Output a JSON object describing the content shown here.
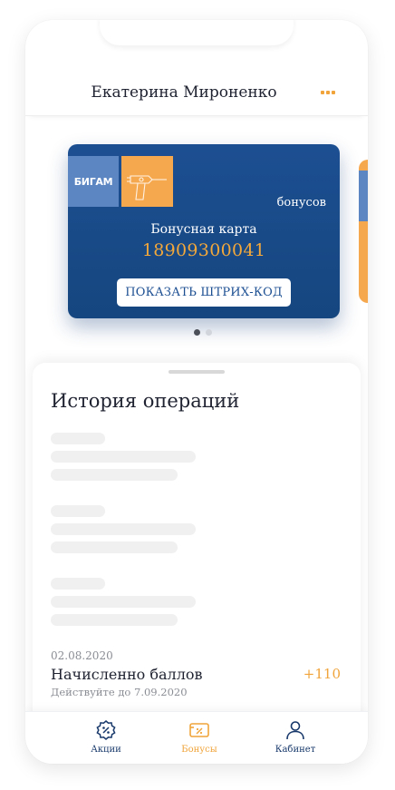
{
  "header": {
    "user_name": "Екатерина Мироненко",
    "more_icon": "more-dots-icon"
  },
  "card": {
    "logo_text": "БИГАМ",
    "bonus_label": "бонусов",
    "type_label": "Бонусная карта",
    "number": "18909300041",
    "barcode_button": "ПОКАЗАТЬ ШТРИХ-КОД"
  },
  "pager": {
    "count": 2,
    "active_index": 0
  },
  "history": {
    "title": "История операций",
    "operations": [
      {
        "date": "02.08.2020",
        "title": "Начисленно баллов",
        "amount": "+110",
        "valid_until": "Действуйте до 7.09.2020"
      }
    ]
  },
  "tabs": [
    {
      "label": "Акции",
      "icon": "discount-icon",
      "active": false
    },
    {
      "label": "Бонусы",
      "icon": "bonus-card-icon",
      "active": true
    },
    {
      "label": "Кабинет",
      "icon": "user-icon",
      "active": false
    }
  ],
  "colors": {
    "accent": "#f0a43a",
    "card_blue": "#1c4f92",
    "nav_blue": "#17386a"
  }
}
